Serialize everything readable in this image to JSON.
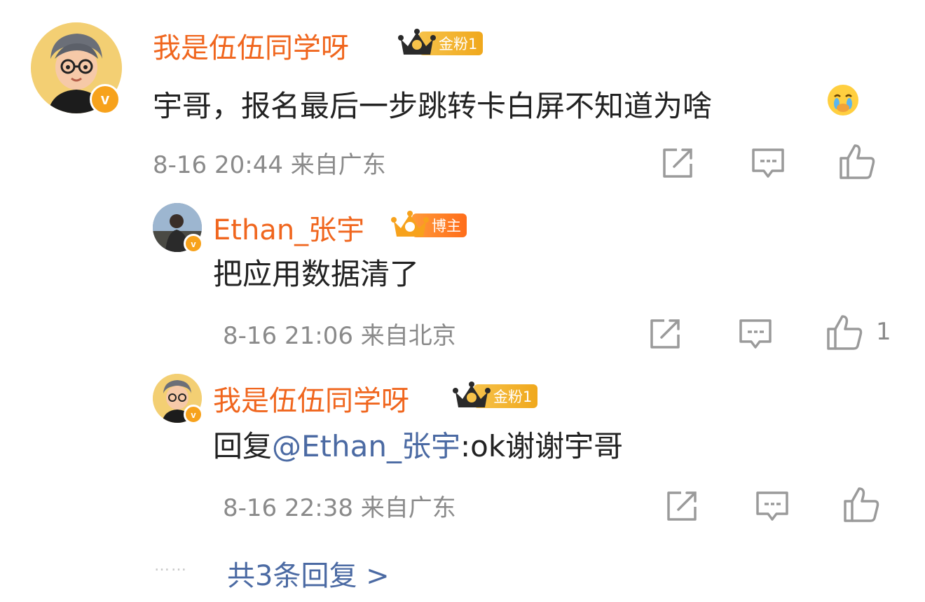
{
  "comment": {
    "user": "我是伍伍同学呀",
    "badge": "金粉1",
    "text": "宇哥，报名最后一步跳转卡白屏不知道为啥",
    "emoji": "cry-face-emoji",
    "meta": "8-16 20:44 来自广东",
    "like_count": ""
  },
  "replies": [
    {
      "user": "Ethan_张宇",
      "badge": "博主",
      "text": "把应用数据清了",
      "meta": "8-16 21:06 来自北京",
      "like_count": "1"
    },
    {
      "user": "我是伍伍同学呀",
      "badge": "金粉1",
      "reply_prefix": "回复",
      "mention": "@Ethan_张宇",
      "reply_text": ":ok谢谢宇哥",
      "meta": "8-16 22:38 来自广东",
      "like_count": ""
    }
  ],
  "footer": {
    "dots": "……",
    "more_label": "共3条回复 >"
  },
  "colors": {
    "name": "#f0661e",
    "link": "#4b6aa3",
    "meta": "#8a8a8a",
    "icon": "#9a9a9a",
    "verified": "#f7a21c"
  },
  "icons": [
    "share-icon",
    "comment-icon",
    "like-icon",
    "crown-icon",
    "verified-icon"
  ]
}
